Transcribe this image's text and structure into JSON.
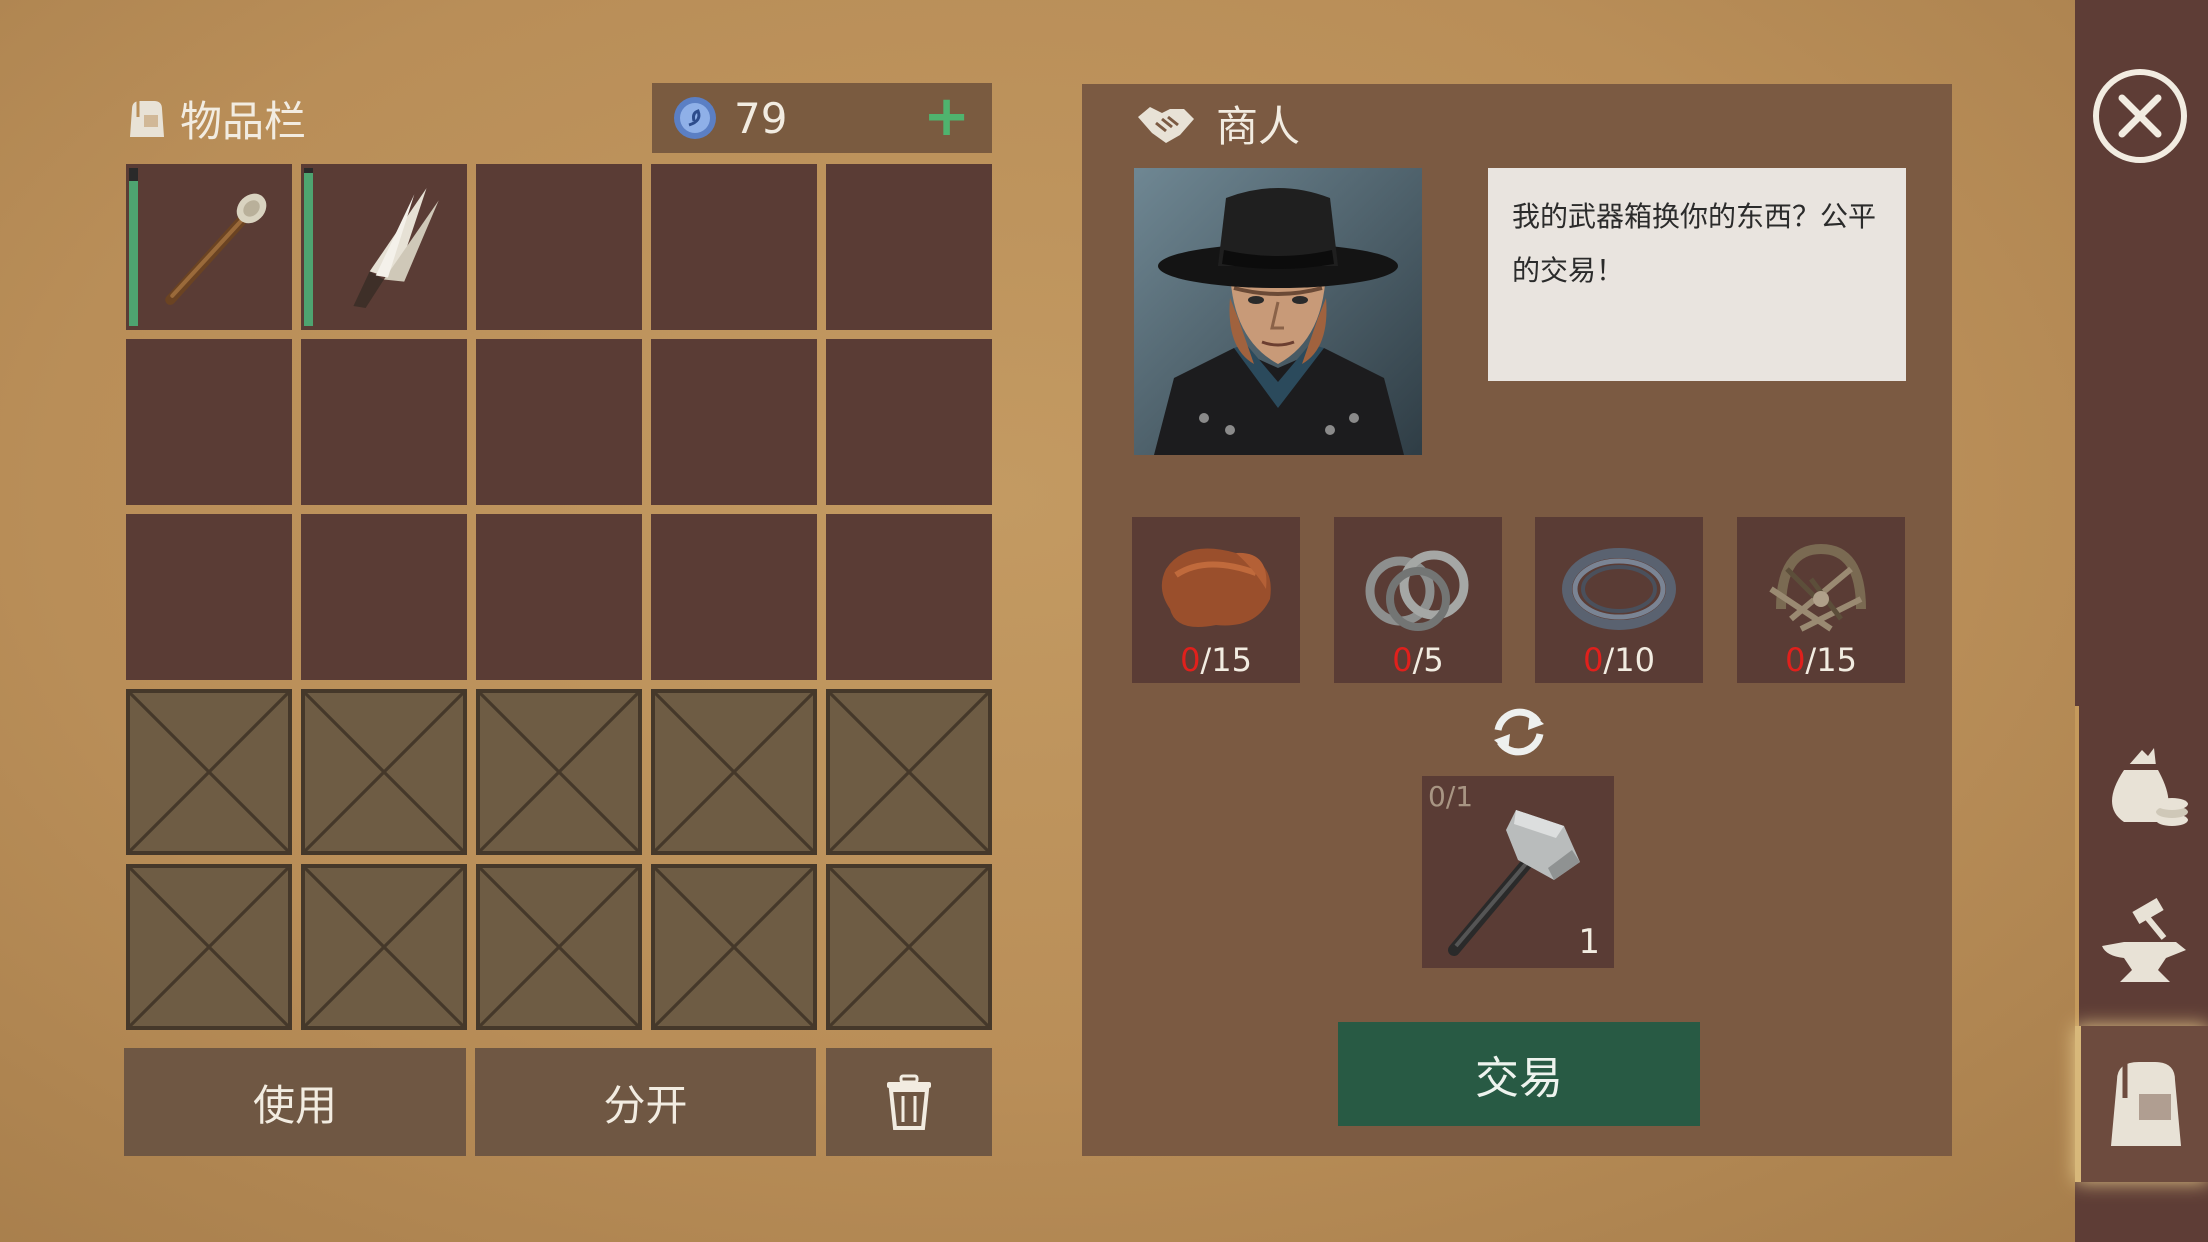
{
  "inventory": {
    "title": "物品栏",
    "currency_amount": "79",
    "currency_add": "+",
    "slots": [
      {
        "item": "torch",
        "durability": 0.92
      },
      {
        "item": "bone-knife",
        "durability": 0.97
      },
      {
        "item": null
      },
      {
        "item": null
      },
      {
        "item": null
      },
      {
        "item": null
      },
      {
        "item": null
      },
      {
        "item": null
      },
      {
        "item": null
      },
      {
        "item": null
      },
      {
        "item": null
      },
      {
        "item": null
      },
      {
        "item": null
      },
      {
        "item": null
      },
      {
        "item": null
      }
    ],
    "locked_slots": 10,
    "buttons": {
      "use": "使用",
      "split": "分开"
    }
  },
  "merchant": {
    "title": "商人",
    "dialogue": "我的武器箱换你的东西？公平的交易！",
    "requirements": [
      {
        "item": "leather",
        "have": "0",
        "need": "/15"
      },
      {
        "item": "iron-rings",
        "have": "0",
        "need": "/5"
      },
      {
        "item": "wire-coil",
        "have": "0",
        "need": "/10"
      },
      {
        "item": "scrap-metal",
        "have": "0",
        "need": "/15"
      }
    ],
    "result": {
      "item": "hammer",
      "counter": "0/1",
      "quantity": "1"
    },
    "trade_button": "交易"
  },
  "colors": {
    "background": "#b98e58",
    "slot": "#5a3c35",
    "trade_button": "#285a44",
    "missing_count": "#e0201c",
    "durability": "#4ea470"
  }
}
